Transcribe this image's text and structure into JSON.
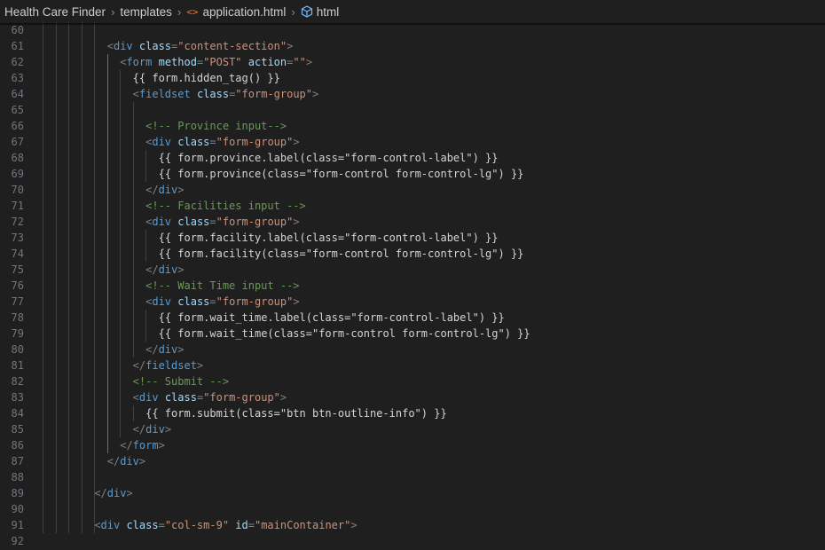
{
  "breadcrumb": {
    "project": "Health Care Finder",
    "folder": "templates",
    "file": "application.html",
    "file_icon": "<>",
    "symbol": "html"
  },
  "editor": {
    "colors": {
      "background": "#1f1f1f",
      "line_number": "#6e7681",
      "tag": "#569cd6",
      "attribute": "#9cdcfe",
      "string": "#ce9178",
      "comment": "#6a9955",
      "punctuation": "#808080",
      "text": "#d4d4d4"
    },
    "lines": [
      {
        "n": "60",
        "indent": 0,
        "tokens": []
      },
      {
        "n": "61",
        "indent": 0,
        "tokens": []
      },
      {
        "n": "62",
        "indent": 0,
        "tokens": []
      },
      {
        "n": "63",
        "indent": 0,
        "tokens": []
      },
      {
        "n": "64",
        "indent": 0,
        "tokens": []
      },
      {
        "n": "65",
        "indent": 0,
        "tokens": []
      },
      {
        "n": "66",
        "indent": 0,
        "tokens": []
      },
      {
        "n": "67",
        "indent": 0,
        "tokens": []
      },
      {
        "n": "68",
        "indent": 0,
        "tokens": []
      },
      {
        "n": "69",
        "indent": 0,
        "tokens": []
      },
      {
        "n": "70",
        "indent": 0,
        "tokens": []
      },
      {
        "n": "71",
        "indent": 0,
        "tokens": []
      },
      {
        "n": "72",
        "indent": 0,
        "tokens": []
      },
      {
        "n": "73",
        "indent": 0,
        "tokens": []
      },
      {
        "n": "74",
        "indent": 0,
        "tokens": []
      },
      {
        "n": "75",
        "indent": 0,
        "tokens": []
      },
      {
        "n": "76",
        "indent": 0,
        "tokens": []
      },
      {
        "n": "77",
        "indent": 0,
        "tokens": []
      },
      {
        "n": "78",
        "indent": 0,
        "tokens": []
      },
      {
        "n": "79",
        "indent": 0,
        "tokens": []
      },
      {
        "n": "80",
        "indent": 0,
        "tokens": []
      },
      {
        "n": "81",
        "indent": 0,
        "tokens": []
      },
      {
        "n": "82",
        "indent": 0,
        "tokens": []
      },
      {
        "n": "83",
        "indent": 0,
        "tokens": []
      },
      {
        "n": "84",
        "indent": 0,
        "tokens": []
      },
      {
        "n": "85",
        "indent": 0,
        "tokens": []
      },
      {
        "n": "86",
        "indent": 0,
        "tokens": []
      },
      {
        "n": "87",
        "indent": 0,
        "tokens": []
      },
      {
        "n": "88",
        "indent": 0,
        "tokens": []
      },
      {
        "n": "89",
        "indent": 0,
        "tokens": []
      },
      {
        "n": "90",
        "indent": 0,
        "tokens": []
      },
      {
        "n": "91",
        "indent": 0,
        "tokens": []
      },
      {
        "n": "92",
        "indent": 0,
        "tokens": []
      }
    ],
    "code": [
      [],
      [
        [
          "p",
          "<"
        ],
        [
          "g",
          "div"
        ],
        [
          "t",
          " "
        ],
        [
          "a",
          "class"
        ],
        [
          "p",
          "="
        ],
        [
          "s",
          "\"content-section\""
        ],
        [
          "p",
          ">"
        ]
      ],
      [
        [
          "p",
          "<"
        ],
        [
          "g",
          "form"
        ],
        [
          "t",
          " "
        ],
        [
          "a",
          "method"
        ],
        [
          "p",
          "="
        ],
        [
          "s",
          "\"POST\""
        ],
        [
          "t",
          " "
        ],
        [
          "a",
          "action"
        ],
        [
          "p",
          "="
        ],
        [
          "s",
          "\"\""
        ],
        [
          "p",
          ">"
        ]
      ],
      [
        [
          "t",
          "{{ form.hidden_tag() }}"
        ]
      ],
      [
        [
          "p",
          "<"
        ],
        [
          "g",
          "fieldset"
        ],
        [
          "t",
          " "
        ],
        [
          "a",
          "class"
        ],
        [
          "p",
          "="
        ],
        [
          "s",
          "\"form-group\""
        ],
        [
          "p",
          ">"
        ]
      ],
      [],
      [
        [
          "c",
          "<!-- Province input-->"
        ]
      ],
      [
        [
          "p",
          "<"
        ],
        [
          "g",
          "div"
        ],
        [
          "t",
          " "
        ],
        [
          "a",
          "class"
        ],
        [
          "p",
          "="
        ],
        [
          "s",
          "\"form-group\""
        ],
        [
          "p",
          ">"
        ]
      ],
      [
        [
          "t",
          "{{ form.province.label(class=\"form-control-label\") }}"
        ]
      ],
      [
        [
          "t",
          "{{ form.province(class=\"form-control form-control-lg\") }}"
        ]
      ],
      [
        [
          "p",
          "</"
        ],
        [
          "g",
          "div"
        ],
        [
          "p",
          ">"
        ]
      ],
      [
        [
          "c",
          "<!-- Facilities input -->"
        ]
      ],
      [
        [
          "p",
          "<"
        ],
        [
          "g",
          "div"
        ],
        [
          "t",
          " "
        ],
        [
          "a",
          "class"
        ],
        [
          "p",
          "="
        ],
        [
          "s",
          "\"form-group\""
        ],
        [
          "p",
          ">"
        ]
      ],
      [
        [
          "t",
          "{{ form.facility.label(class=\"form-control-label\") }}"
        ]
      ],
      [
        [
          "t",
          "{{ form.facility(class=\"form-control form-control-lg\") }}"
        ]
      ],
      [
        [
          "p",
          "</"
        ],
        [
          "g",
          "div"
        ],
        [
          "p",
          ">"
        ]
      ],
      [
        [
          "c",
          "<!-- Wait Time input -->"
        ]
      ],
      [
        [
          "p",
          "<"
        ],
        [
          "g",
          "div"
        ],
        [
          "t",
          " "
        ],
        [
          "a",
          "class"
        ],
        [
          "p",
          "="
        ],
        [
          "s",
          "\"form-group\""
        ],
        [
          "p",
          ">"
        ]
      ],
      [
        [
          "t",
          "{{ form.wait_time.label(class=\"form-control-label\") }}"
        ]
      ],
      [
        [
          "t",
          "{{ form.wait_time(class=\"form-control form-control-lg\") }}"
        ]
      ],
      [
        [
          "p",
          "</"
        ],
        [
          "g",
          "div"
        ],
        [
          "p",
          ">"
        ]
      ],
      [
        [
          "p",
          "</"
        ],
        [
          "g",
          "fieldset"
        ],
        [
          "p",
          ">"
        ]
      ],
      [
        [
          "c",
          "<!-- Submit -->"
        ]
      ],
      [
        [
          "p",
          "<"
        ],
        [
          "g",
          "div"
        ],
        [
          "t",
          " "
        ],
        [
          "a",
          "class"
        ],
        [
          "p",
          "="
        ],
        [
          "s",
          "\"form-group\""
        ],
        [
          "p",
          ">"
        ]
      ],
      [
        [
          "t",
          "{{ form.submit(class=\"btn btn-outline-info\") }}"
        ]
      ],
      [
        [
          "p",
          "</"
        ],
        [
          "g",
          "div"
        ],
        [
          "p",
          ">"
        ]
      ],
      [
        [
          "p",
          "</"
        ],
        [
          "g",
          "form"
        ],
        [
          "p",
          ">"
        ]
      ],
      [
        [
          "p",
          "</"
        ],
        [
          "g",
          "div"
        ],
        [
          "p",
          ">"
        ]
      ],
      [],
      [
        [
          "p",
          "</"
        ],
        [
          "g",
          "div"
        ],
        [
          "p",
          ">"
        ]
      ],
      [],
      [
        [
          "p",
          "<"
        ],
        [
          "g",
          "div"
        ],
        [
          "t",
          " "
        ],
        [
          "a",
          "class"
        ],
        [
          "p",
          "="
        ],
        [
          "s",
          "\"col-sm-9\""
        ],
        [
          "t",
          " "
        ],
        [
          "a",
          "id"
        ],
        [
          "p",
          "="
        ],
        [
          "s",
          "\"mainContainer\""
        ],
        [
          "p",
          ">"
        ]
      ],
      []
    ]
  }
}
